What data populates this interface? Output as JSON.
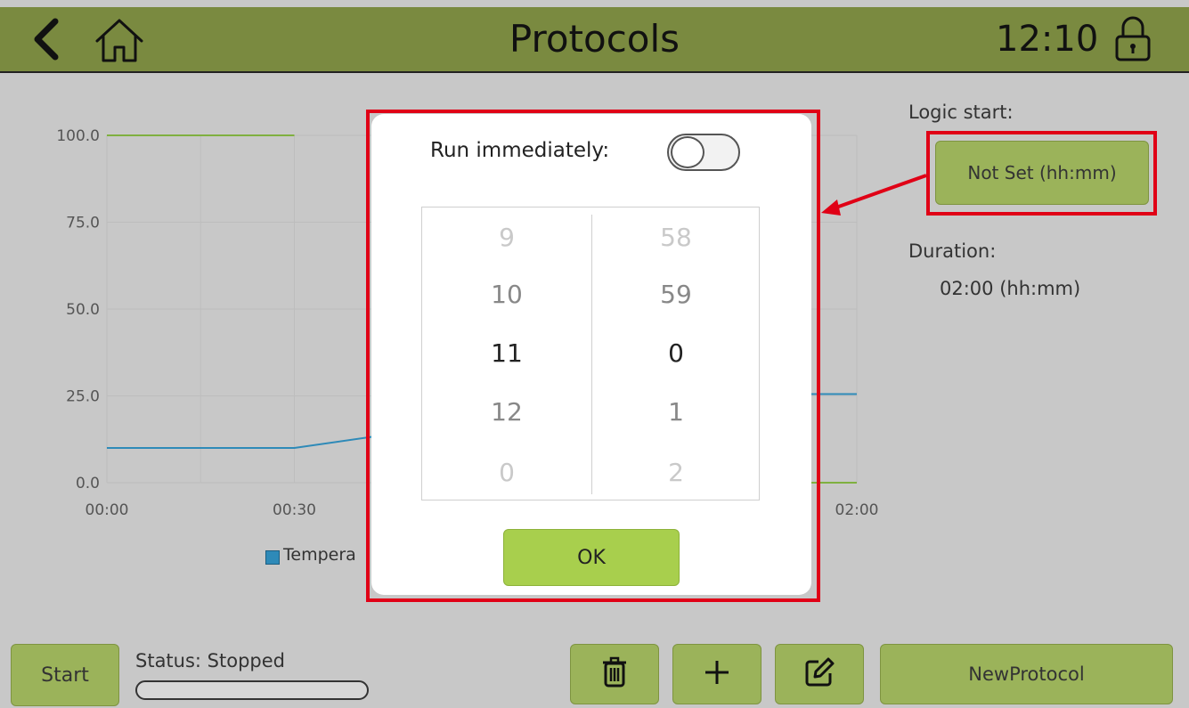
{
  "header": {
    "title": "Protocols",
    "time": "12:10",
    "icons": {
      "back": "back-chevron-icon",
      "home": "home-icon",
      "lock": "lock-icon"
    },
    "color": "#7a8a40"
  },
  "chart_data": {
    "type": "line",
    "x_ticks": [
      "00:00",
      "00:30",
      "02:00"
    ],
    "y_ticks": [
      "0.0",
      "25.0",
      "50.0",
      "75.0",
      "100.0"
    ],
    "ylim": [
      0,
      100
    ],
    "grid": true,
    "legend_text": "Tempera",
    "legend_color": "#2e8ab8",
    "series": [
      {
        "color": "#2e8ab8",
        "points": [
          [
            0,
            10
          ],
          [
            0.5,
            10
          ],
          [
            1.5,
            25.5
          ],
          [
            2,
            25.5
          ]
        ]
      },
      {
        "color": "#7fb040",
        "points": [
          [
            0,
            100
          ],
          [
            0.5,
            100
          ]
        ]
      },
      {
        "color": "#7fb040",
        "points": [
          [
            1.75,
            0
          ],
          [
            2,
            0
          ]
        ]
      }
    ]
  },
  "right_panel": {
    "logic_start_label": "Logic start:",
    "logic_start_button": "Not Set (hh:mm)",
    "duration_label": "Duration:",
    "duration_value": "02:00 (hh:mm)"
  },
  "modal": {
    "run_immediately_label": "Run immediately:",
    "toggle_on": false,
    "hours": [
      "9",
      "10",
      "11",
      "12",
      "0"
    ],
    "minutes": [
      "58",
      "59",
      "0",
      "1",
      "2"
    ],
    "ok_label": "OK"
  },
  "bottom": {
    "start_label": "Start",
    "status_label": "Status: Stopped",
    "progress": 0,
    "delete_icon": "trash-icon",
    "add_icon": "plus-icon",
    "edit_icon": "edit-icon",
    "protocol_name": "NewProtocol"
  },
  "highlight_color": "#e00016"
}
